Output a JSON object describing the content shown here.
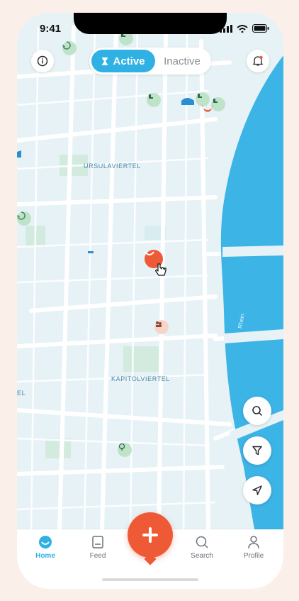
{
  "status_bar": {
    "time": "9:41"
  },
  "header": {
    "info_button": "info-icon",
    "toggle": {
      "active_label": "Active",
      "inactive_label": "Inactive"
    },
    "notification_button": "bell-icon"
  },
  "map": {
    "labels": {
      "district_1": "URSULAVIERTEL",
      "district_2": "KAPITOLVIERTEL",
      "partial_edge": "EL",
      "river": "Rhein"
    }
  },
  "map_controls": {
    "search": "search-icon",
    "filter": "filter-icon",
    "locate": "navigation-arrow-icon"
  },
  "tabbar": {
    "tabs": [
      {
        "label": "Home",
        "active": true
      },
      {
        "label": "Feed",
        "active": false
      },
      {
        "label": "Search",
        "active": false
      },
      {
        "label": "Profile",
        "active": false
      }
    ],
    "add_button": "plus-icon"
  },
  "colors": {
    "accent": "#2fb2e3",
    "brand_orange": "#ef5a36",
    "water": "#3cb4e6",
    "map_bg": "#e6f2f6"
  }
}
